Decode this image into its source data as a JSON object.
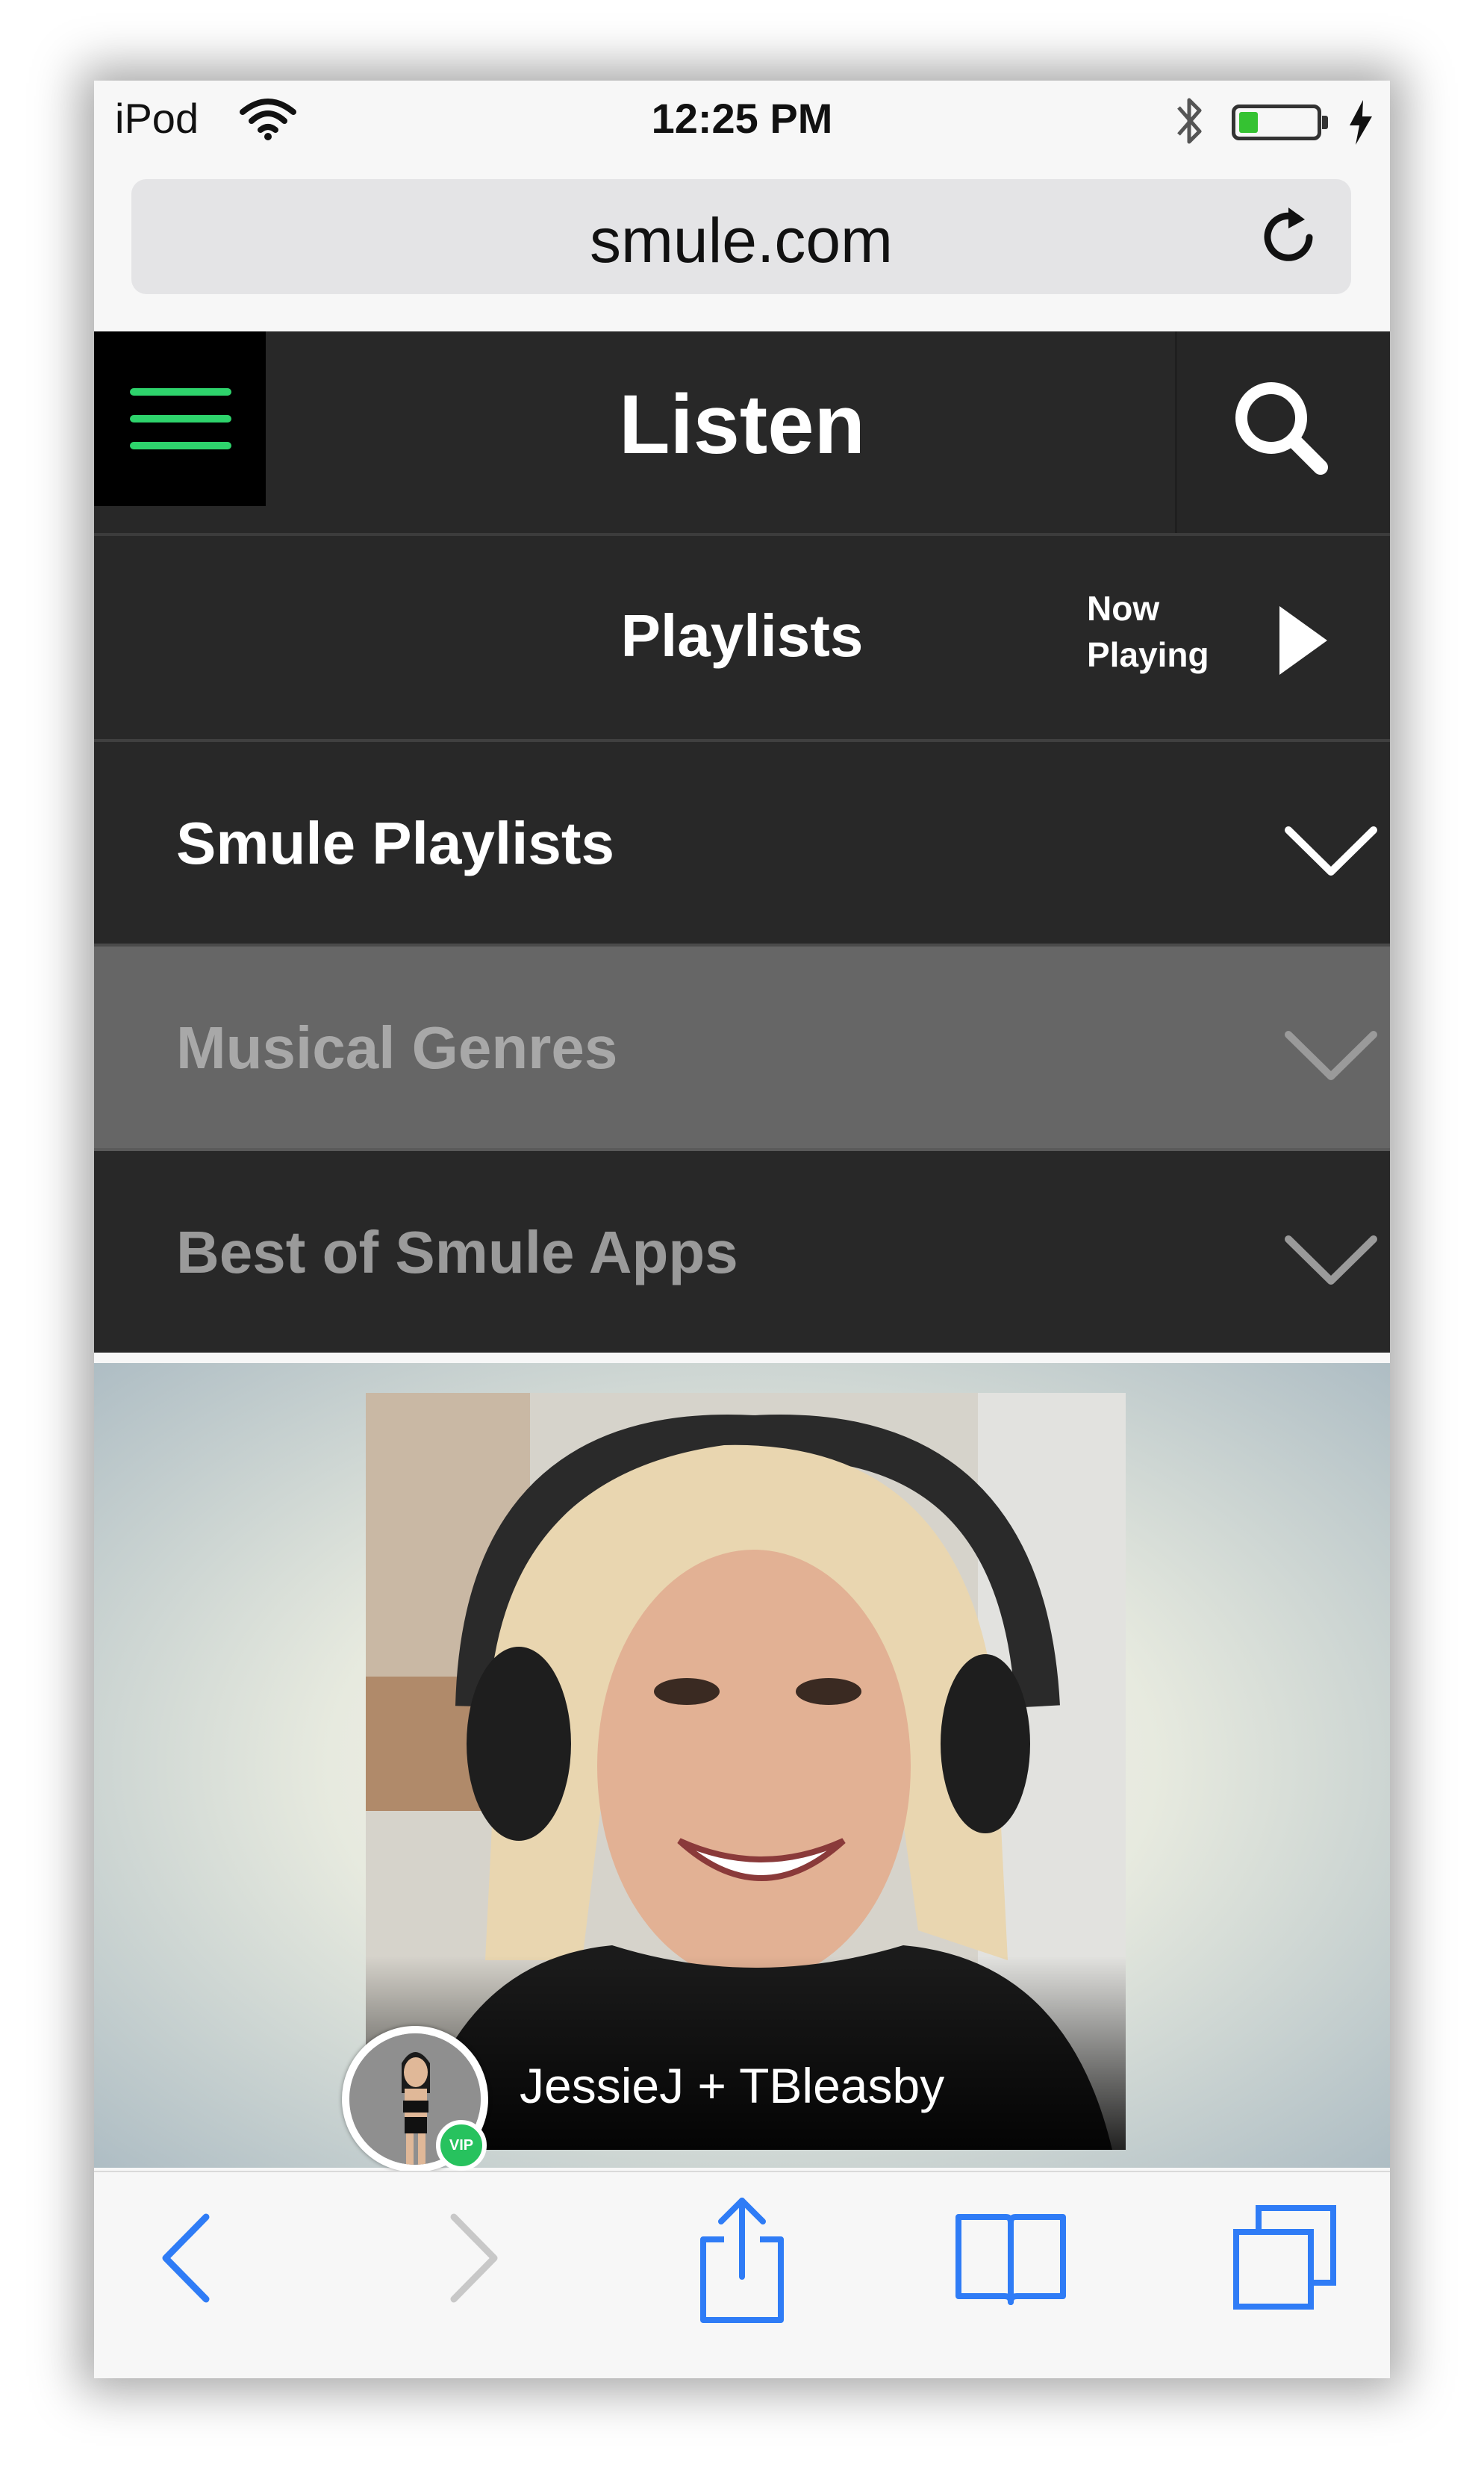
{
  "status_bar": {
    "carrier": "iPod",
    "time": "12:25 PM",
    "battery_fraction": 0.25
  },
  "browser": {
    "url": "smule.com"
  },
  "app_header": {
    "title": "Listen"
  },
  "playlists_bar": {
    "label": "Playlists",
    "now_playing_line1": "Now",
    "now_playing_line2": "Playing"
  },
  "accordion": [
    {
      "label": "Smule Playlists"
    },
    {
      "label": "Musical Genres"
    },
    {
      "label": "Best of Smule Apps"
    }
  ],
  "featured": {
    "caption": "JessieJ + TBleasby",
    "badge": "VIP"
  },
  "colors": {
    "accent_green": "#2ed36c",
    "header_dark": "#282828",
    "highlight_row": "#666666",
    "ios_blue": "#2f7cf6"
  },
  "icons": {
    "menu": "hamburger-icon",
    "search": "search-icon",
    "play": "play-icon",
    "expand": "chevron-down-icon",
    "back": "back-arrow-icon",
    "forward": "forward-arrow-icon",
    "share": "share-icon",
    "bookmarks": "bookmarks-icon",
    "tabs": "tabs-icon"
  }
}
